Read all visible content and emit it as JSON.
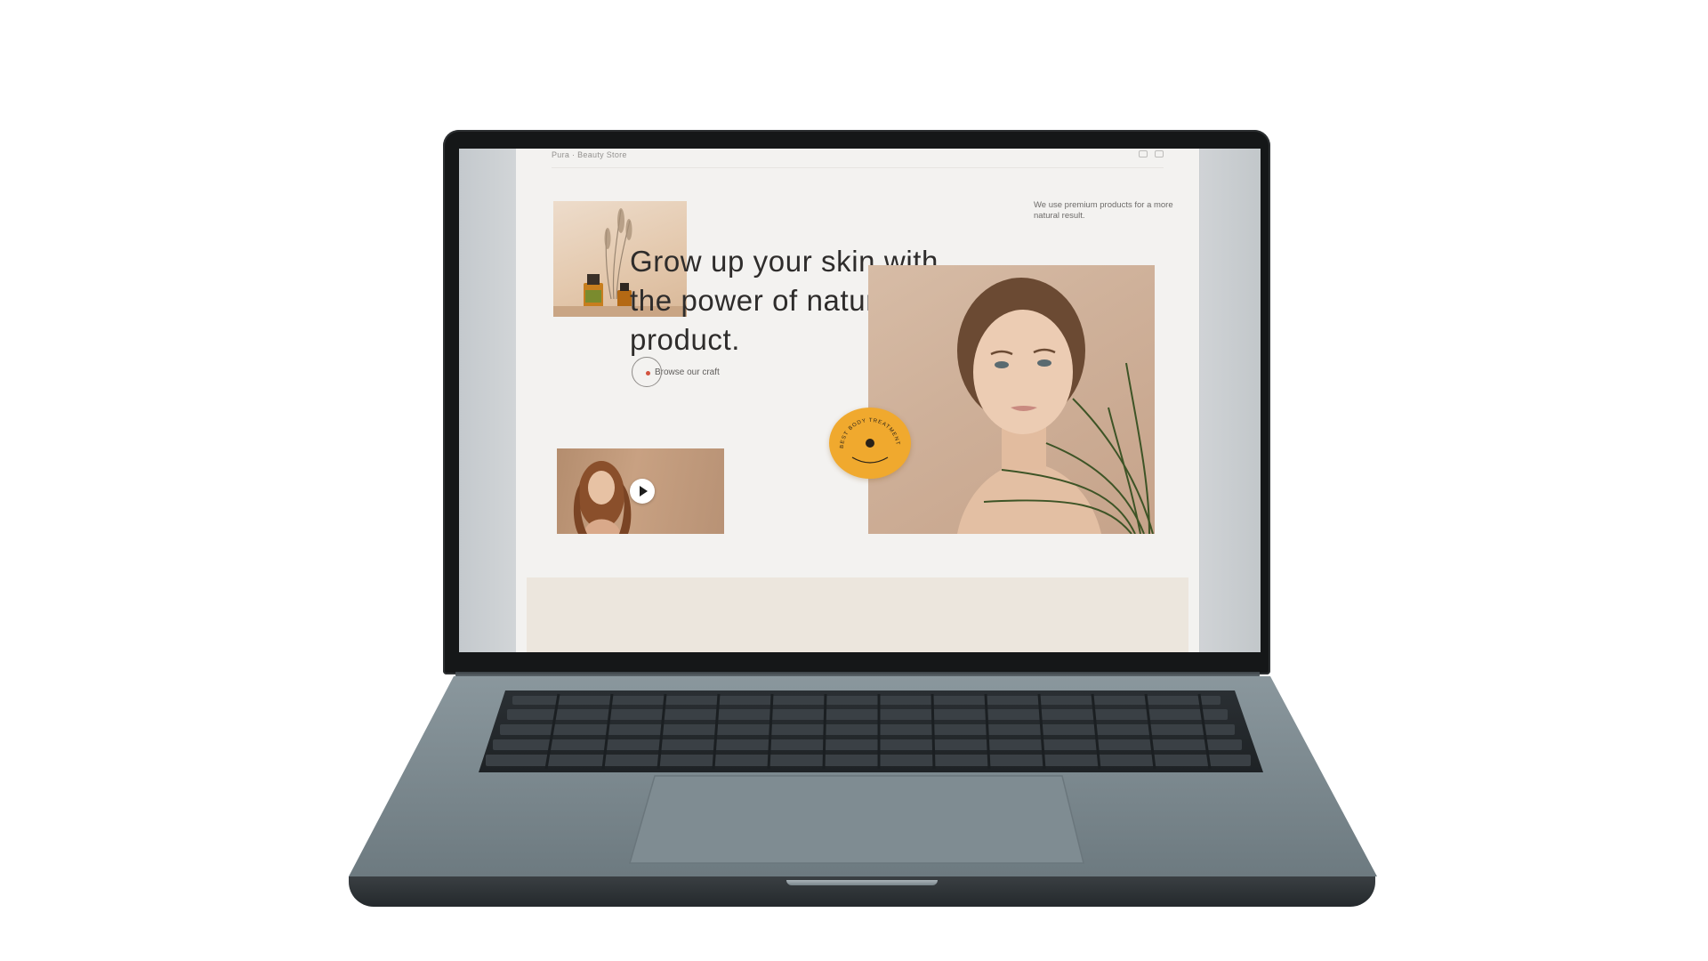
{
  "webpage": {
    "brand": "Pura · Beauty Store",
    "tagline": "We use premium products for a more natural result.",
    "hero_title": "Grow up your skin with the power of natural product.",
    "cta_label": "Browse our craft",
    "badge_text": "BEST BODY TREATMENT IN TOWN"
  },
  "icons": {
    "play": "play-icon",
    "search": "search-icon",
    "cart": "cart-icon"
  },
  "colors": {
    "page_bg": "#f3f2f0",
    "accent_badge": "#f0a92e",
    "cta_dot": "#d3533f",
    "text_dark": "#2e2c2b",
    "laptop_body": "#7b8a91",
    "laptop_bezel": "#151718"
  }
}
